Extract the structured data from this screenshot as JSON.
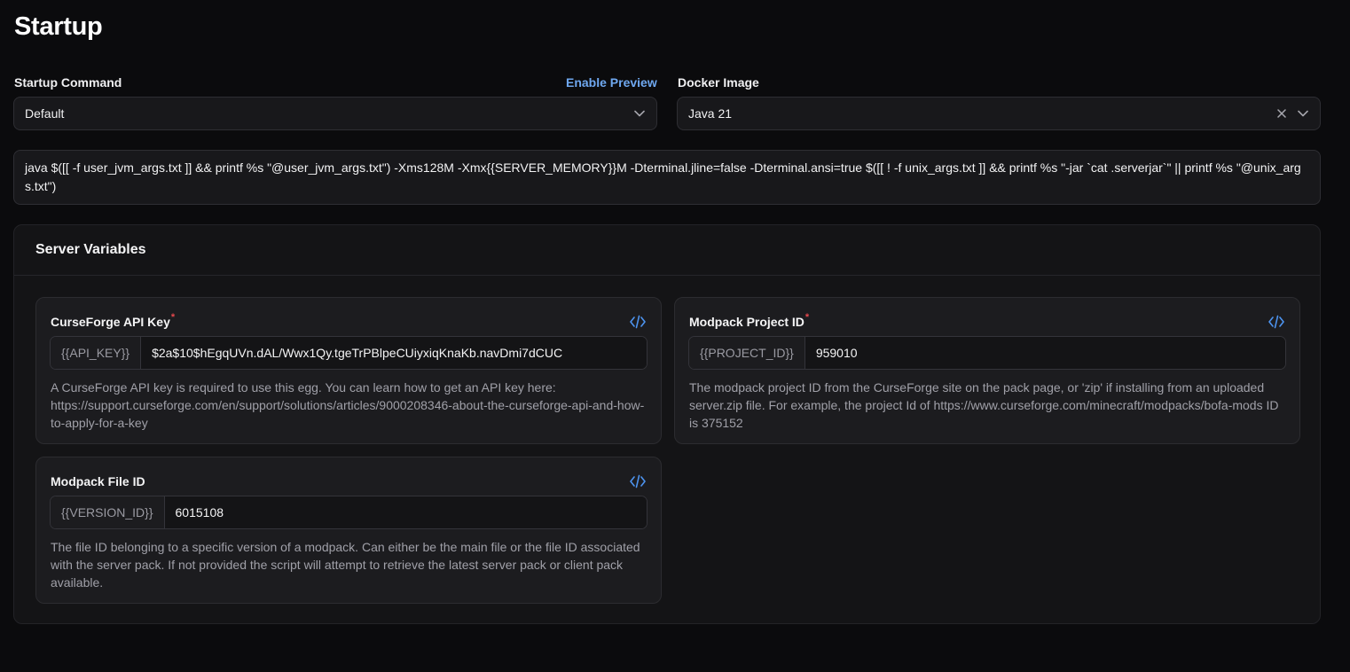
{
  "page": {
    "title": "Startup"
  },
  "startup_command": {
    "label": "Startup Command",
    "preview_link": "Enable Preview",
    "selected": "Default"
  },
  "docker_image": {
    "label": "Docker Image",
    "selected": "Java 21"
  },
  "command_text": "java $([[ -f user_jvm_args.txt ]] && printf %s \"@user_jvm_args.txt\") -Xms128M -Xmx{{SERVER_MEMORY}}M -Dterminal.jline=false -Dterminal.ansi=true $([[ ! -f unix_args.txt ]] && printf %s \"-jar `cat .serverjar`\" || printf %s \"@unix_args.txt\")",
  "server_variables": {
    "title": "Server Variables",
    "variables": [
      {
        "title": "CurseForge API Key",
        "required_mark": "*",
        "env": "{{API_KEY}}",
        "value": "$2a$10$hEgqUVn.dAL/Wwx1Qy.tgeTrPBlpeCUiyxiqKnaKb.navDmi7dCUC",
        "description": "A CurseForge API key is required to use this egg. You can learn how to get an API key here: https://support.curseforge.com/en/support/solutions/articles/9000208346-about-the-curseforge-api-and-how-to-apply-for-a-key"
      },
      {
        "title": "Modpack Project ID",
        "required_mark": "*",
        "env": "{{PROJECT_ID}}",
        "value": "959010",
        "description": "The modpack project ID from the CurseForge site on the pack page, or 'zip' if installing from an uploaded server.zip file. For example, the project Id of https://www.curseforge.com/minecraft/modpacks/bofa-mods ID is 375152"
      },
      {
        "title": "Modpack File ID",
        "required_mark": "",
        "env": "{{VERSION_ID}}",
        "value": "6015108",
        "description": "The file ID belonging to a specific version of a modpack. Can either be the main file or the file ID associated with the server pack. If not provided the script will attempt to retrieve the latest server pack or client pack available."
      }
    ]
  },
  "icons": {
    "dropdown": "chevron-down-icon",
    "clear": "close-icon",
    "code": "code-icon"
  },
  "colors": {
    "background": "#0b0b0d",
    "accent_link": "#6fa8f0",
    "required": "#e5484d"
  }
}
